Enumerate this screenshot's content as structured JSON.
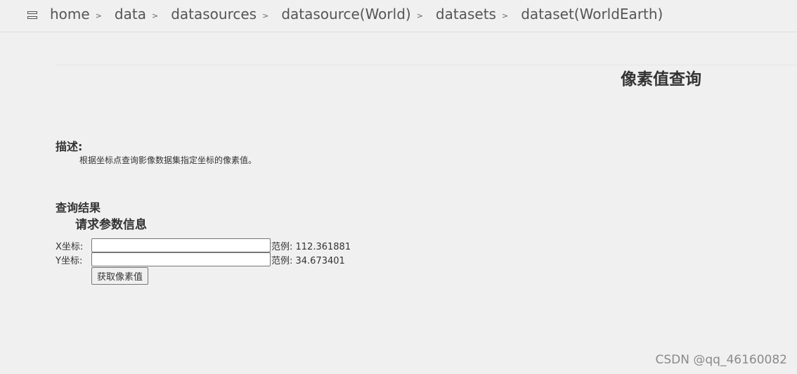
{
  "breadcrumb": {
    "items": [
      "home",
      "data",
      "datasources",
      "datasource(World)",
      "datasets",
      "dataset(WorldEarth)"
    ],
    "separator": ">"
  },
  "page": {
    "title": "像素值查询"
  },
  "description": {
    "heading": "描述:",
    "text": "根据坐标点查询影像数据集指定坐标的像素值。"
  },
  "results": {
    "heading": "查询结果"
  },
  "request": {
    "heading": "请求参数信息",
    "x_label": "X坐标:",
    "x_value": "",
    "x_example": "范例: 112.361881",
    "y_label": "Y坐标:",
    "y_value": "",
    "y_example": "范例: 34.673401",
    "submit_label": "获取像素值"
  },
  "watermark": "CSDN @qq_46160082"
}
